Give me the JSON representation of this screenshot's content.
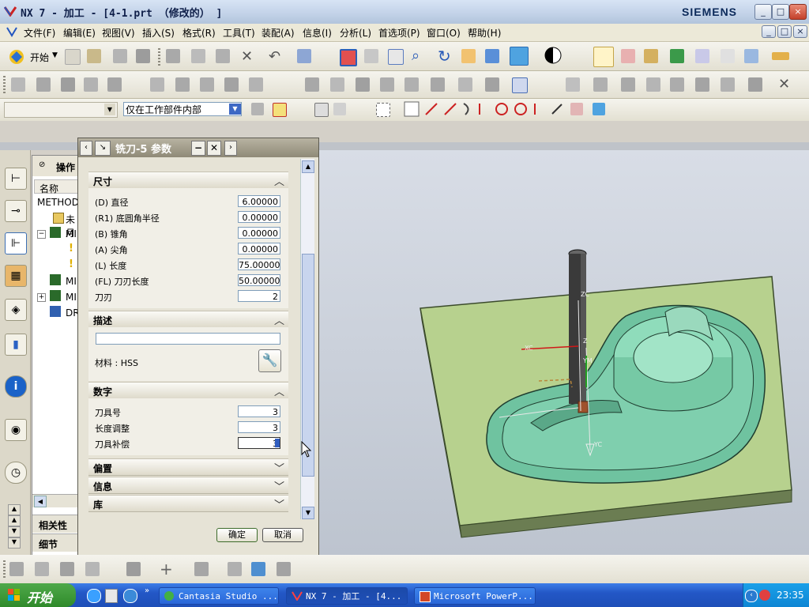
{
  "window": {
    "title": "NX 7 - 加工 - [4-1.prt （修改的） ]",
    "brand": "SIEMENS",
    "controls": [
      "_",
      "□",
      "×"
    ]
  },
  "menu": [
    "文件(F)",
    "编辑(E)",
    "视图(V)",
    "插入(S)",
    "格式(R)",
    "工具(T)",
    "装配(A)",
    "信息(I)",
    "分析(L)",
    "首选项(P)",
    "窗口(O)",
    "帮助(H)"
  ],
  "toolbar": {
    "start_label": "开始",
    "filter_selected": "仅在工作部件内部"
  },
  "navigator": {
    "header": "操作",
    "column_name": "名称",
    "items": [
      "METHOD",
      "未月",
      "MI",
      "MI",
      "MI",
      "DR"
    ],
    "bottom_tabs": [
      "相关性",
      "细节"
    ]
  },
  "dialog": {
    "title": "铣刀-5 参数",
    "sections": {
      "dimensions": "尺寸",
      "description": "描述",
      "numbers": "数字",
      "offset": "偏置",
      "info": "信息",
      "library": "库"
    },
    "dimension_fields": [
      {
        "label": "(D) 直径",
        "value": "6.00000"
      },
      {
        "label": "(R1) 底圆角半径",
        "value": "0.00000"
      },
      {
        "label": "(B) 锥角",
        "value": "0.00000"
      },
      {
        "label": "(A) 尖角",
        "value": "0.00000"
      },
      {
        "label": "(L) 长度",
        "value": "75.00000"
      },
      {
        "label": "(FL) 刀刃长度",
        "value": "50.00000"
      },
      {
        "label": "刀刃",
        "value": "2"
      }
    ],
    "description_value": "",
    "material": "材料 : HSS",
    "number_fields": [
      {
        "label": "刀具号",
        "value": "3"
      },
      {
        "label": "长度调整",
        "value": "3"
      },
      {
        "label": "刀具补偿",
        "value": "3"
      }
    ],
    "ok_label": "确定",
    "cancel_label": "取消"
  },
  "graphics": {
    "axis_labels": [
      "ZC",
      "XC",
      "Z",
      "YM",
      "YC"
    ]
  },
  "taskbar": {
    "start": "开始",
    "tasks": [
      "Cantasia Studio ...",
      "NX 7 - 加工 - [4...",
      "Microsoft PowerP..."
    ],
    "clock": "23:35"
  },
  "colors": {
    "part_green": "#6fc3a0",
    "base_plate": "#b7d18e",
    "tool_dark": "#3a3a3a",
    "taskbar_blue": "#2357c6",
    "dialog_bg": "#e6e3d6"
  }
}
